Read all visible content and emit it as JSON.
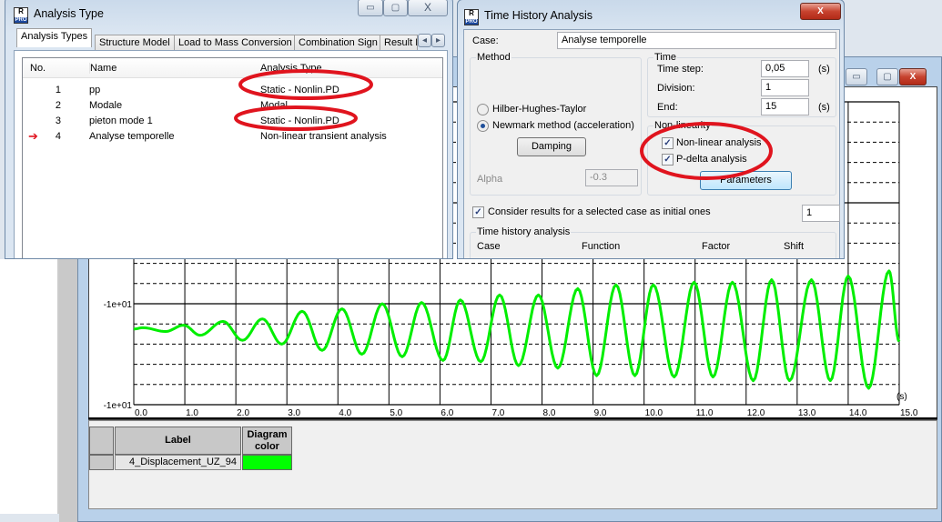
{
  "analysis_type_dialog": {
    "title": "Analysis Type",
    "tabs": [
      "Analysis Types",
      "Structure Model",
      "Load to Mass Conversion",
      "Combination Sign",
      "Result F"
    ],
    "columns": [
      "No.",
      "Name",
      "Analysis Type"
    ],
    "rows": [
      {
        "no": "1",
        "name": "pp",
        "type": "Static - Nonlin.PD",
        "highlighted": true
      },
      {
        "no": "2",
        "name": "Modale",
        "type": "Modal",
        "highlighted": false
      },
      {
        "no": "3",
        "name": "pieton mode 1",
        "type": "Static - Nonlin.PD",
        "highlighted": true
      },
      {
        "no": "4",
        "name": "Analyse temporelle",
        "type": "Non-linear transient analysis",
        "current": true
      }
    ]
  },
  "time_history_dialog": {
    "title": "Time History Analysis",
    "case_label": "Case:",
    "case_value": "Analyse temporelle",
    "method": {
      "label": "Method",
      "options": [
        "Hilber-Hughes-Taylor",
        "Newmark method (acceleration)"
      ],
      "selected": "Newmark method (acceleration)",
      "damping_button": "Damping",
      "alpha_label": "Alpha",
      "alpha_value": "-0.3"
    },
    "time": {
      "label": "Time",
      "time_step_label": "Time step:",
      "time_step": "0,05",
      "time_step_unit": "(s)",
      "division_label": "Division:",
      "division": "1",
      "end_label": "End:",
      "end": "15",
      "end_unit": "(s)"
    },
    "nonlinearity": {
      "label": "Non-linearity",
      "nonlinear_label": "Non-linear analysis",
      "nonlinear_checked": true,
      "pdelta_label": "P-delta analysis",
      "pdelta_checked": true,
      "parameters_button": "Parameters"
    },
    "initial": {
      "label": "Consider results for a selected case as initial ones",
      "checked": true,
      "value": "1"
    },
    "history": {
      "label": "Time history analysis",
      "columns": [
        "Case",
        "Function",
        "Factor",
        "Shift"
      ]
    }
  },
  "chart_data": {
    "type": "line",
    "xlabel": "(s)",
    "xlim": [
      0,
      15
    ],
    "ylim": [
      -10.4,
      -8.0
    ],
    "x_ticks": [
      "0.0",
      "1.0",
      "2.0",
      "3.0",
      "4.0",
      "5.0",
      "6.0",
      "7.0",
      "8.0",
      "9.0",
      "10.0",
      "11.0",
      "12.0",
      "13.0",
      "14.0",
      "15.0"
    ],
    "y_ticks": [
      {
        "value": -9.6,
        "label": "-1e+01"
      },
      {
        "value": -10.4,
        "label": "-1e+01"
      }
    ],
    "grid": true,
    "series": [
      {
        "name": "4_Displacement_UZ_94",
        "color": "#00ee00",
        "points": [
          [
            0,
            -9.8
          ],
          [
            0.18,
            -9.79
          ],
          [
            0.62,
            -9.82
          ],
          [
            0.98,
            -9.77
          ],
          [
            1.3,
            -9.85
          ],
          [
            1.75,
            -9.74
          ],
          [
            2.13,
            -9.89
          ],
          [
            2.52,
            -9.72
          ],
          [
            2.9,
            -9.92
          ],
          [
            3.3,
            -9.66
          ],
          [
            3.69,
            -9.97
          ],
          [
            4.08,
            -9.64
          ],
          [
            4.47,
            -10.0
          ],
          [
            4.87,
            -9.6
          ],
          [
            5.26,
            -10.02
          ],
          [
            5.64,
            -9.59
          ],
          [
            6.06,
            -10.05
          ],
          [
            6.4,
            -9.57
          ],
          [
            6.8,
            -10.06
          ],
          [
            7.17,
            -9.53
          ],
          [
            7.54,
            -10.09
          ],
          [
            7.93,
            -9.53
          ],
          [
            8.31,
            -10.11
          ],
          [
            8.7,
            -9.48
          ],
          [
            9.07,
            -10.17
          ],
          [
            9.45,
            -9.45
          ],
          [
            9.82,
            -10.17
          ],
          [
            10.18,
            -9.45
          ],
          [
            10.59,
            -10.18
          ],
          [
            10.98,
            -9.43
          ],
          [
            11.35,
            -10.18
          ],
          [
            11.73,
            -9.43
          ],
          [
            12.14,
            -10.21
          ],
          [
            12.5,
            -9.41
          ],
          [
            12.85,
            -10.21
          ],
          [
            13.28,
            -9.41
          ],
          [
            13.65,
            -10.21
          ],
          [
            14.0,
            -9.38
          ],
          [
            14.4,
            -10.27
          ],
          [
            14.8,
            -9.34
          ],
          [
            15.0,
            -9.9
          ]
        ]
      }
    ]
  },
  "legend_table": {
    "columns": [
      "Label",
      "Diagram color"
    ],
    "rows": [
      {
        "label": "4_Displacement_UZ_94",
        "color": "#00ff00"
      }
    ]
  },
  "annotation_color": "#e0141e"
}
